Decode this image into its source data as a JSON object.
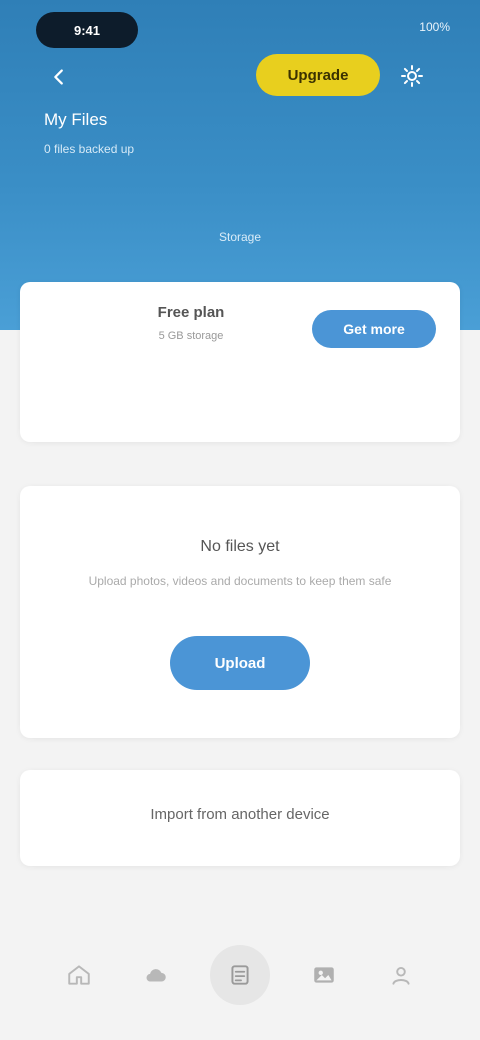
{
  "status_bar": {
    "time": "9:41",
    "battery": "100%"
  },
  "header": {
    "upgrade_label": "Upgrade",
    "title": "My Files",
    "subtitle": "0 files backed up",
    "caption": "Storage"
  },
  "plan_card": {
    "name": "Free plan",
    "description": "5 GB storage",
    "button_label": "Get more",
    "note": ""
  },
  "empty_state": {
    "title": "No files yet",
    "description": "Upload photos, videos and documents to keep them safe",
    "button_label": "Upload"
  },
  "link_card": {
    "label": "Import from another device"
  },
  "tabbar": {
    "items": [
      {
        "icon": "home-icon",
        "active": false
      },
      {
        "icon": "cloud-icon",
        "active": false
      },
      {
        "icon": "files-icon",
        "active": true
      },
      {
        "icon": "photos-icon",
        "active": false
      },
      {
        "icon": "profile-icon",
        "active": false
      }
    ]
  },
  "colors": {
    "hero_top": "#2f7fb7",
    "hero_bottom": "#4a9fd6",
    "accent_yellow": "#e8cf1e",
    "accent_blue": "#4b95d6"
  }
}
